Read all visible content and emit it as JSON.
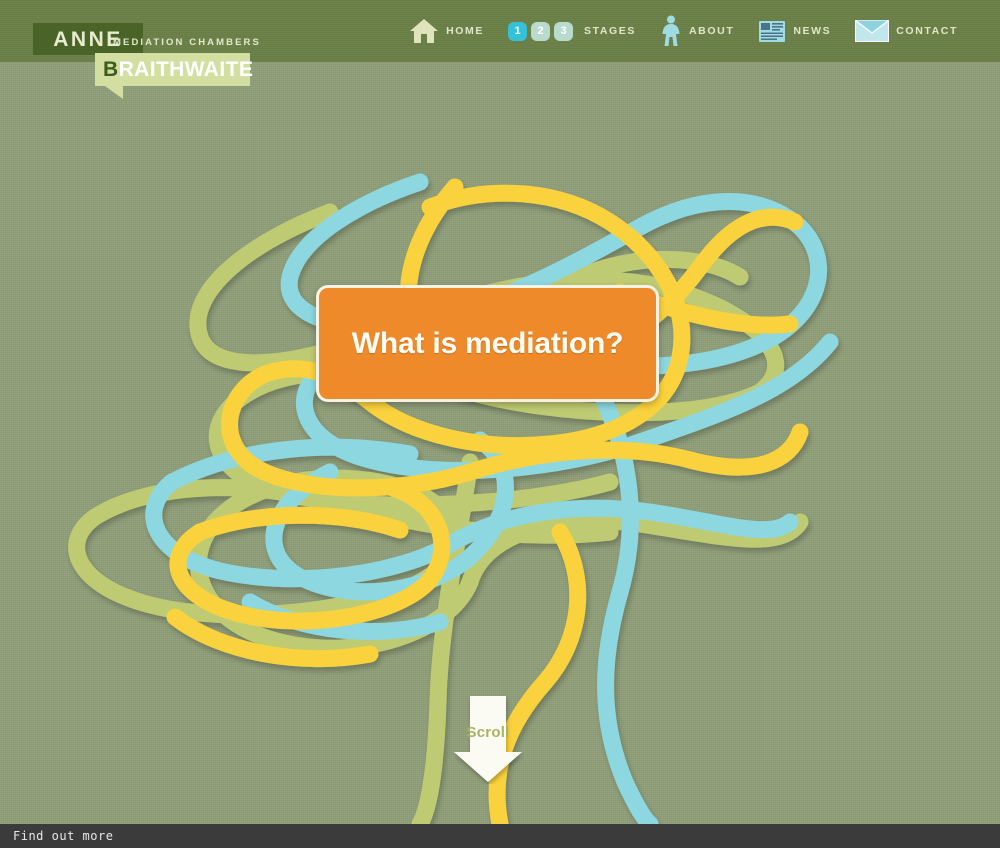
{
  "site": {
    "logo": {
      "name_first": "ANNE",
      "name_last_initial": "B",
      "name_last_rest": "RAITHWAITE",
      "tagline": "MEDIATION CHAMBERS"
    },
    "colors": {
      "header_green": "#6b8048",
      "page_green": "#8f9e78",
      "logo_dark_green": "#4a6327",
      "logo_light_green": "#d2dfa0",
      "cta_orange": "#ef8a2b",
      "ribbon_yellow": "#fad23c",
      "ribbon_cyan": "#8cd7e0",
      "ribbon_olive": "#bfcb72",
      "stage_active_cyan": "#35c2d8",
      "stage_inactive": "#b8dbcd",
      "statusbar": "#3b3b3b"
    }
  },
  "nav": {
    "items": [
      {
        "label": "HOME",
        "icon": "home-icon"
      },
      {
        "label": "STAGES",
        "icon": "stages-numbers-icon"
      },
      {
        "label": "ABOUT",
        "icon": "person-icon"
      },
      {
        "label": "NEWS",
        "icon": "newspaper-icon"
      },
      {
        "label": "CONTACT",
        "icon": "envelope-icon"
      }
    ],
    "stages": [
      {
        "number": "1",
        "state": "active"
      },
      {
        "number": "2",
        "state": "inactive"
      },
      {
        "number": "3",
        "state": "inactive"
      }
    ]
  },
  "hero": {
    "cta_label": "What is mediation?",
    "scroll_label": "Scroll"
  },
  "statusbar": {
    "text": "Find out more"
  }
}
